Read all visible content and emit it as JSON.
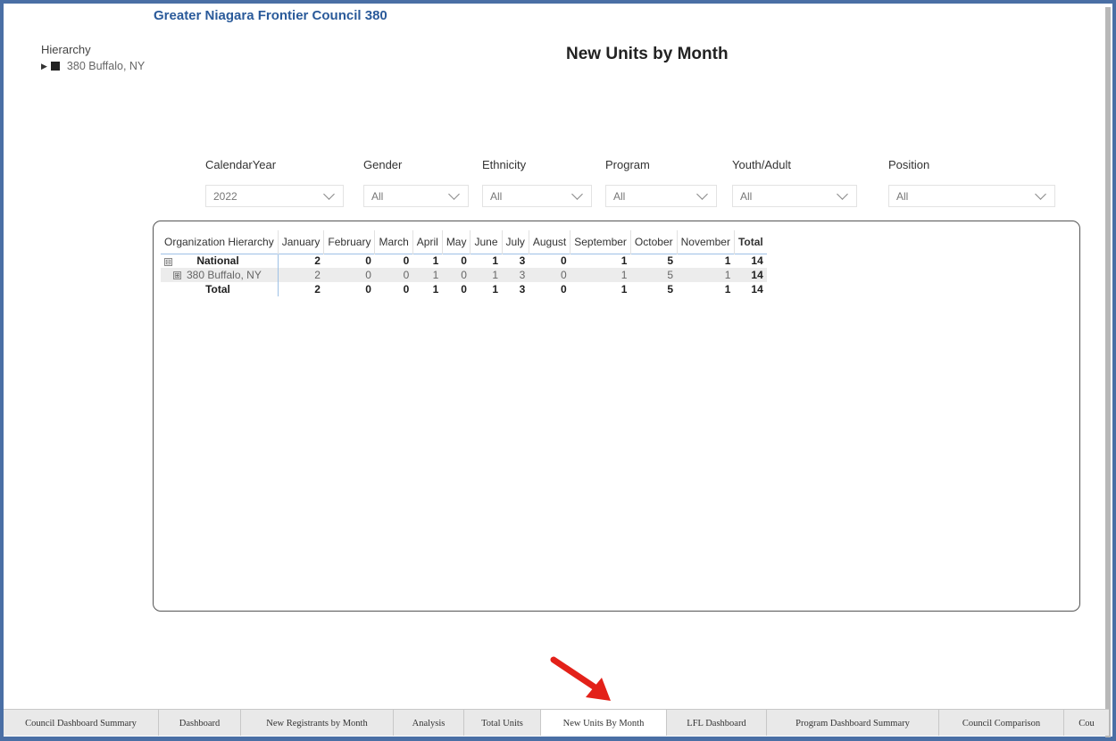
{
  "report": {
    "title": "Greater Niagara Frontier Council 380"
  },
  "hierarchy": {
    "label": "Hierarchy",
    "item": "380 Buffalo, NY"
  },
  "page": {
    "title": "New Units by Month"
  },
  "slicers": [
    {
      "label": "CalendarYear",
      "value": "2022"
    },
    {
      "label": "Gender",
      "value": "All"
    },
    {
      "label": "Ethnicity",
      "value": "All"
    },
    {
      "label": "Program",
      "value": "All"
    },
    {
      "label": "Youth/Adult",
      "value": "All"
    },
    {
      "label": "Position",
      "value": "All"
    }
  ],
  "matrix": {
    "columns": [
      "Organization Hierarchy",
      "January",
      "February",
      "March",
      "April",
      "May",
      "June",
      "July",
      "August",
      "September",
      "October",
      "November",
      "Total"
    ],
    "rows": [
      {
        "name": "National",
        "expander": "⊟",
        "values": [
          "2",
          "0",
          "0",
          "1",
          "0",
          "1",
          "3",
          "0",
          "1",
          "5",
          "1",
          "14"
        ]
      },
      {
        "name": "380 Buffalo, NY",
        "expander": "⊞",
        "values": [
          "2",
          "0",
          "0",
          "1",
          "0",
          "1",
          "3",
          "0",
          "1",
          "5",
          "1",
          "14"
        ]
      },
      {
        "name": "Total",
        "values": [
          "2",
          "0",
          "0",
          "1",
          "0",
          "1",
          "3",
          "0",
          "1",
          "5",
          "1",
          "14"
        ]
      }
    ]
  },
  "annotation": {
    "arrow_color": "#e32119"
  },
  "tabs": [
    {
      "label": "Council Dashboard Summary",
      "active": false
    },
    {
      "label": "Dashboard",
      "active": false
    },
    {
      "label": "New Registrants by Month",
      "active": false
    },
    {
      "label": "Analysis",
      "active": false
    },
    {
      "label": "Total Units",
      "active": false
    },
    {
      "label": "New Units By Month",
      "active": true
    },
    {
      "label": "LFL Dashboard",
      "active": false
    },
    {
      "label": "Program Dashboard Summary",
      "active": false
    },
    {
      "label": "Council Comparison",
      "active": false
    },
    {
      "label": "Cou",
      "active": false
    }
  ]
}
